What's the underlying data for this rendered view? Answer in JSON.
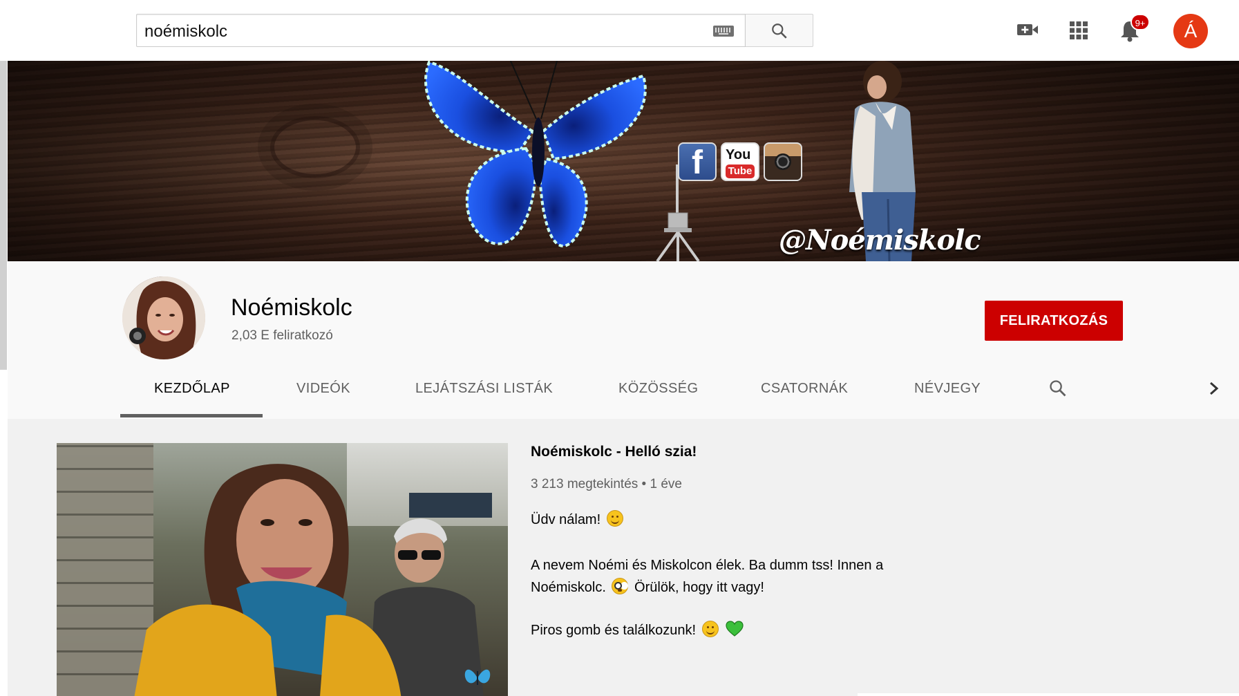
{
  "masthead": {
    "search_value": "noémiskolc",
    "notification_count": "9+",
    "account_initial": "Á",
    "icons": [
      "keyboard-icon",
      "search-icon",
      "create-video-icon",
      "apps-grid-icon",
      "notifications-bell-icon"
    ]
  },
  "banner": {
    "handle": "@Noémiskolc",
    "social_badges": {
      "facebook": "f",
      "youtube_top": "You",
      "youtube_bottom": "Tube",
      "instagram": "instagram"
    }
  },
  "channel": {
    "name": "Noémiskolc",
    "subscribers": "2,03 E feliratkozó",
    "subscribe_label": "FELIRATKOZÁS"
  },
  "tabs": [
    {
      "label": "KEZDŐLAP",
      "active": true
    },
    {
      "label": "VIDEÓK",
      "active": false
    },
    {
      "label": "LEJÁTSZÁSI LISTÁK",
      "active": false
    },
    {
      "label": "KÖZÖSSÉG",
      "active": false
    },
    {
      "label": "CSATORNÁK",
      "active": false
    },
    {
      "label": "NÉVJEGY",
      "active": false
    }
  ],
  "featured": {
    "title": "Noémiskolc - Helló szia!",
    "meta": "3 213 megtekintés • 1 éve",
    "desc": {
      "line1": "Üdv nálam!",
      "line2": "A nevem Noémi és Miskolcon élek. Ba dumm tss! Innen a",
      "line3a": "Noémiskolc.",
      "line3b": "Örülök, hogy itt vagy!",
      "line4": "Piros gomb és találkozunk!"
    }
  },
  "colors": {
    "brand_red": "#cc0000",
    "account_avatar": "#e53914",
    "butterfly_blue": "#1a4fe0",
    "heart_green": "#3bbf3b"
  }
}
